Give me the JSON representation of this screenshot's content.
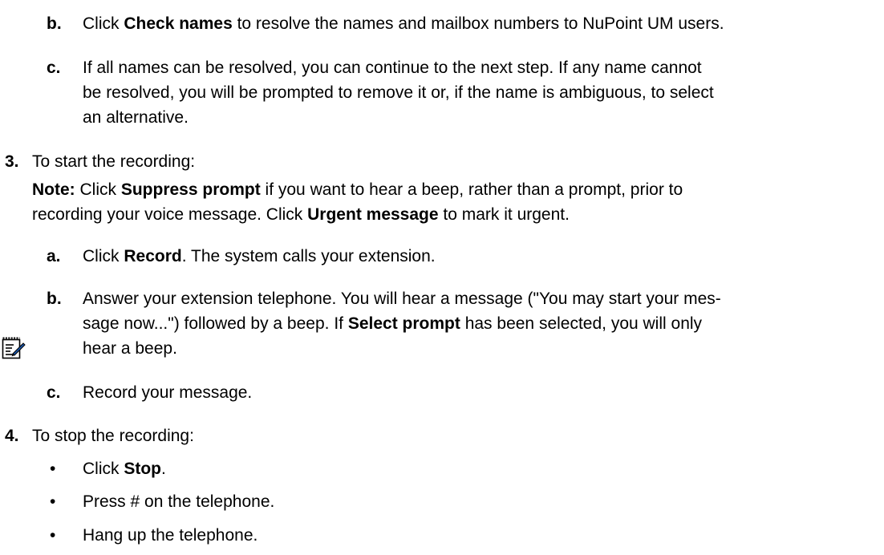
{
  "step2": {
    "b": {
      "marker": "b.",
      "parts": [
        "Click ",
        "Check names",
        " to resolve the names and mailbox numbers to NuPoint UM users."
      ]
    },
    "c": {
      "marker": "c.",
      "lines": [
        "If all names can be resolved, you can continue to the next step. If any name cannot",
        "be resolved, you will be prompted to remove it or, if the name is ambiguous, to select",
        "an alternative."
      ]
    }
  },
  "step3": {
    "marker": "3.",
    "text": "To start the recording:",
    "note": {
      "icon": "note-pencil-icon",
      "label": "Note:",
      "line1_parts": [
        " Click ",
        "Suppress prompt",
        " if you want to hear a beep, rather than a prompt, prior to"
      ],
      "line2_parts": [
        "recording your voice message. Click ",
        "Urgent message",
        " to mark it urgent."
      ]
    },
    "a": {
      "marker": "a.",
      "parts": [
        "Click ",
        "Record",
        ". The system calls your extension."
      ]
    },
    "b": {
      "marker": "b.",
      "line1": "Answer your extension telephone. You will hear a message (\"You may start your mes-",
      "line2_parts": [
        "sage now...\") followed by a beep. If ",
        "Select prompt",
        " has been selected, you will only"
      ],
      "line3": "hear a beep."
    },
    "c": {
      "marker": "c.",
      "text": "Record your message."
    }
  },
  "step4": {
    "marker": "4.",
    "text": "To stop the recording:",
    "bullet": "•",
    "bullets": [
      {
        "parts": [
          "Click ",
          "Stop",
          "."
        ]
      },
      {
        "parts": [
          "Press # on the telephone."
        ]
      },
      {
        "parts": [
          "Hang up the telephone."
        ]
      }
    ]
  }
}
